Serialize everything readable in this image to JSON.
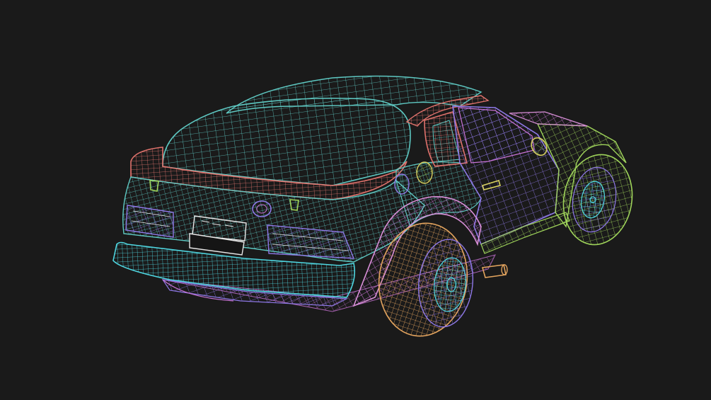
{
  "scene": {
    "subject": "wireframe-sports-car-rear-three-quarter",
    "background": "#1a1a1a",
    "palette": {
      "teal": "#5ec8c2",
      "cyan": "#4fd6e0",
      "coral": "#e0726c",
      "violet": "#8e78e6",
      "magenta": "#c973d6",
      "pink": "#d98fd8",
      "lime": "#9fd45a",
      "yellow": "#d8d060",
      "orange": "#e3a45e",
      "white": "#e8e8e8"
    }
  }
}
